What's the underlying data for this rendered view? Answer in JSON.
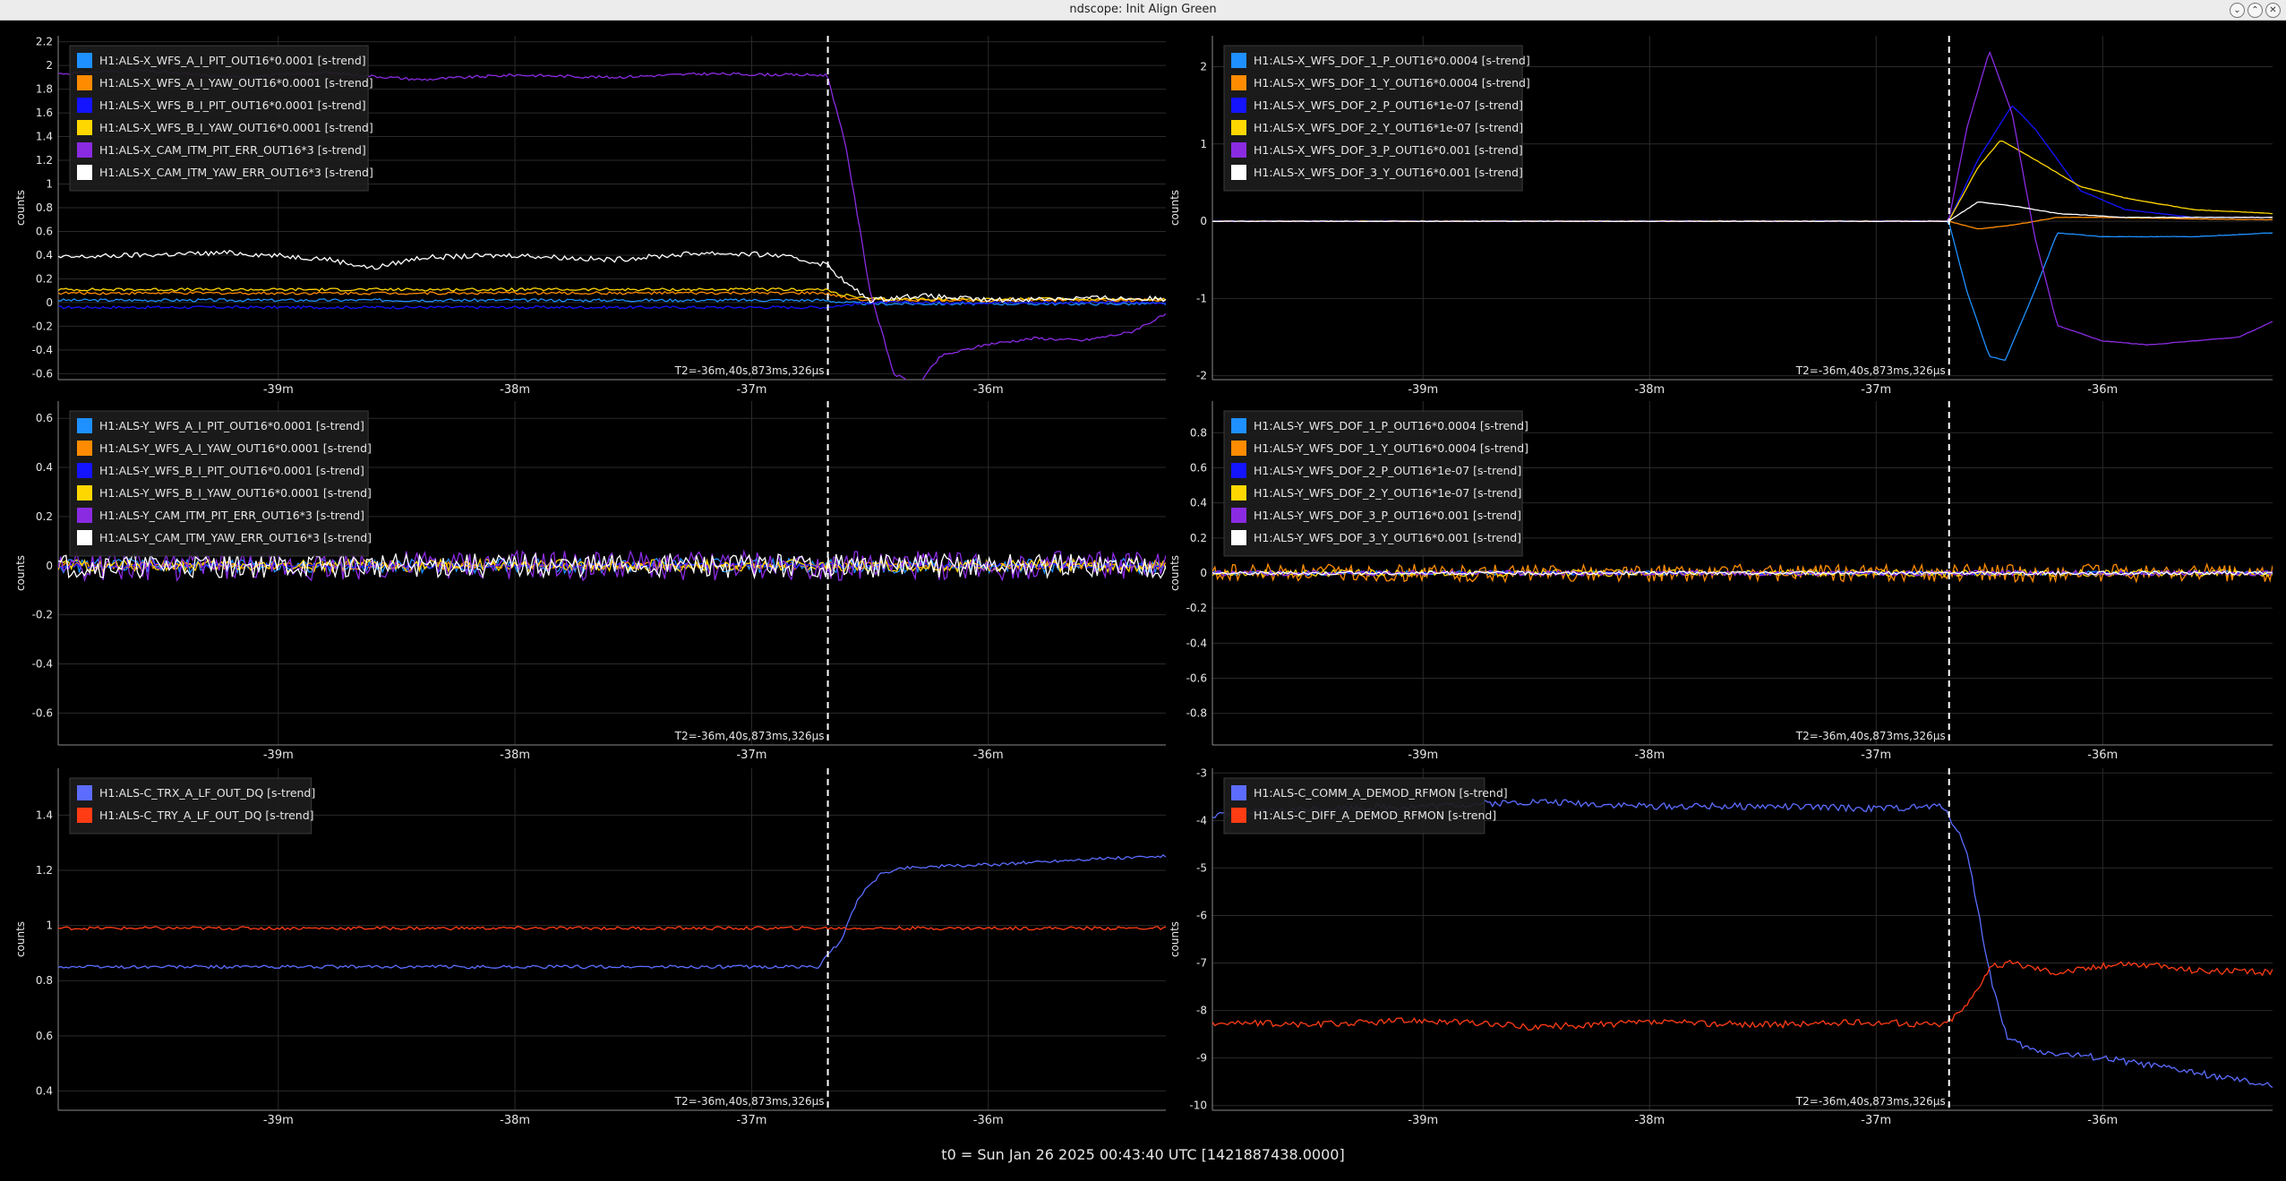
{
  "window": {
    "title": "ndscope: Init Align Green"
  },
  "footer": {
    "t0_text": "t0 = Sun Jan 26 2025 00:43:40 UTC [1421887438.0000]"
  },
  "colors": {
    "background": "#000000",
    "grid": "#2a2a2a",
    "axis": "#8a8a8a",
    "text": "#e6e6e6",
    "legend_bg": "#1c1c1c",
    "cursor": "#ffffff"
  },
  "chart_data": [
    {
      "id": "xarm-wfs",
      "type": "line",
      "ylabel": "counts",
      "ylim": [
        -0.65,
        2.25
      ],
      "yticks": [
        -0.6,
        -0.4,
        -0.2,
        0,
        0.2,
        0.4,
        0.6,
        0.8,
        1,
        1.2,
        1.4,
        1.6,
        1.8,
        2,
        2.2
      ],
      "xlim": [
        -39.93,
        -35.25
      ],
      "xticks": [
        -39,
        -38,
        -37,
        -36
      ],
      "xtick_labels": [
        "-39m",
        "-38m",
        "-37m",
        "-36m"
      ],
      "cursor_x": -36.678,
      "cursor_label": "T2=-36m,40s,873ms,326μs",
      "series": [
        {
          "name": "H1:ALS-X_WFS_A_I_PIT_OUT16*0.0001 [s-trend]",
          "color": "#1e90ff",
          "x": [
            -39.93,
            -36.7,
            -36.6,
            -36.5,
            -35.25
          ],
          "y": [
            0.02,
            0.02,
            0.0,
            -0.01,
            -0.01
          ]
        },
        {
          "name": "H1:ALS-X_WFS_A_I_YAW_OUT16*0.0001 [s-trend]",
          "color": "#ff8c00",
          "x": [
            -39.93,
            -36.7,
            -36.6,
            -36.5,
            -35.25
          ],
          "y": [
            0.08,
            0.08,
            0.04,
            0.02,
            0.02
          ]
        },
        {
          "name": "H1:ALS-X_WFS_B_I_PIT_OUT16*0.0001 [s-trend]",
          "color": "#1414ff",
          "x": [
            -39.93,
            -36.7,
            -36.6,
            -36.5,
            -35.25
          ],
          "y": [
            -0.04,
            -0.04,
            -0.02,
            0.0,
            0.0
          ]
        },
        {
          "name": "H1:ALS-X_WFS_B_I_YAW_OUT16*0.0001 [s-trend]",
          "color": "#ffd700",
          "x": [
            -39.93,
            -36.7,
            -36.6,
            -36.5,
            -35.25
          ],
          "y": [
            0.11,
            0.11,
            0.06,
            0.03,
            0.03
          ]
        },
        {
          "name": "H1:ALS-X_CAM_ITM_PIT_ERR_OUT16*3 [s-trend]",
          "color": "#8a2be2",
          "x": [
            -39.93,
            -39.6,
            -39.2,
            -38.8,
            -38.4,
            -38.0,
            -37.6,
            -37.2,
            -36.8,
            -36.68,
            -36.6,
            -36.5,
            -36.4,
            -36.3,
            -36.2,
            -36.0,
            -35.8,
            -35.6,
            -35.4,
            -35.25
          ],
          "y": [
            1.93,
            1.96,
            1.9,
            1.94,
            1.88,
            1.92,
            1.9,
            1.93,
            1.92,
            1.92,
            1.3,
            0.1,
            -0.6,
            -0.7,
            -0.45,
            -0.35,
            -0.3,
            -0.32,
            -0.25,
            -0.1
          ]
        },
        {
          "name": "H1:ALS-X_CAM_ITM_YAW_ERR_OUT16*3 [s-trend]",
          "color": "#ffffff",
          "x": [
            -39.93,
            -39.6,
            -39.2,
            -38.8,
            -38.6,
            -38.4,
            -38.0,
            -37.6,
            -37.2,
            -36.9,
            -36.68,
            -36.6,
            -36.5,
            -36.3,
            -36.0,
            -35.6,
            -35.25
          ],
          "y": [
            0.38,
            0.4,
            0.42,
            0.37,
            0.29,
            0.38,
            0.4,
            0.36,
            0.42,
            0.4,
            0.32,
            0.16,
            0.02,
            0.06,
            0.02,
            0.04,
            0.03
          ]
        }
      ]
    },
    {
      "id": "xarm-dof",
      "type": "line",
      "ylabel": "counts",
      "ylim": [
        -2.05,
        2.4
      ],
      "yticks": [
        -2,
        -1,
        0,
        1,
        2
      ],
      "xlim": [
        -39.93,
        -35.25
      ],
      "xticks": [
        -39,
        -38,
        -37,
        -36
      ],
      "xtick_labels": [
        "-39m",
        "-38m",
        "-37m",
        "-36m"
      ],
      "cursor_x": -36.678,
      "cursor_label": "T2=-36m,40s,873ms,326μs",
      "series": [
        {
          "name": "H1:ALS-X_WFS_DOF_1_P_OUT16*0.0004 [s-trend]",
          "color": "#1e90ff",
          "x": [
            -39.93,
            -36.68,
            -36.6,
            -36.5,
            -36.43,
            -36.3,
            -36.2,
            -36.0,
            -35.6,
            -35.25
          ],
          "y": [
            0,
            0,
            -0.9,
            -1.75,
            -1.8,
            -0.9,
            -0.15,
            -0.2,
            -0.2,
            -0.15
          ]
        },
        {
          "name": "H1:ALS-X_WFS_DOF_1_Y_OUT16*0.0004 [s-trend]",
          "color": "#ff8c00",
          "x": [
            -39.93,
            -36.68,
            -36.55,
            -36.4,
            -36.2,
            -36.0,
            -35.6,
            -35.25
          ],
          "y": [
            0,
            0,
            -0.1,
            -0.05,
            0.05,
            0.05,
            0.03,
            0.02
          ]
        },
        {
          "name": "H1:ALS-X_WFS_DOF_2_P_OUT16*1e-07 [s-trend]",
          "color": "#1414ff",
          "x": [
            -39.93,
            -36.68,
            -36.55,
            -36.4,
            -36.3,
            -36.1,
            -35.9,
            -35.6,
            -35.25
          ],
          "y": [
            0,
            0,
            0.8,
            1.5,
            1.2,
            0.4,
            0.15,
            0.05,
            0.05
          ]
        },
        {
          "name": "H1:ALS-X_WFS_DOF_2_Y_OUT16*1e-07 [s-trend]",
          "color": "#ffd700",
          "x": [
            -39.93,
            -36.68,
            -36.55,
            -36.45,
            -36.3,
            -36.1,
            -35.9,
            -35.6,
            -35.25
          ],
          "y": [
            0,
            0,
            0.7,
            1.05,
            0.8,
            0.45,
            0.3,
            0.15,
            0.1
          ]
        },
        {
          "name": "H1:ALS-X_WFS_DOF_3_P_OUT16*0.001 [s-trend]",
          "color": "#8a2be2",
          "x": [
            -39.93,
            -36.68,
            -36.6,
            -36.5,
            -36.4,
            -36.3,
            -36.2,
            -36.0,
            -35.8,
            -35.6,
            -35.4,
            -35.25
          ],
          "y": [
            0,
            0,
            1.2,
            2.2,
            1.4,
            -0.2,
            -1.35,
            -1.55,
            -1.6,
            -1.55,
            -1.5,
            -1.3
          ]
        },
        {
          "name": "H1:ALS-X_WFS_DOF_3_Y_OUT16*0.001 [s-trend]",
          "color": "#ffffff",
          "x": [
            -39.93,
            -36.68,
            -36.55,
            -36.4,
            -36.2,
            -35.9,
            -35.25
          ],
          "y": [
            0,
            0,
            0.25,
            0.2,
            0.1,
            0.05,
            0.05
          ]
        }
      ]
    },
    {
      "id": "yarm-wfs",
      "type": "line",
      "ylabel": "counts",
      "ylim": [
        -0.73,
        0.67
      ],
      "yticks": [
        -0.6,
        -0.4,
        -0.2,
        0,
        0.2,
        0.4,
        0.6
      ],
      "xlim": [
        -39.93,
        -35.25
      ],
      "xticks": [
        -39,
        -38,
        -37,
        -36
      ],
      "xtick_labels": [
        "-39m",
        "-38m",
        "-37m",
        "-36m"
      ],
      "cursor_x": -36.678,
      "cursor_label": "T2=-36m,40s,873ms,326μs",
      "series": [
        {
          "name": "H1:ALS-Y_WFS_A_I_PIT_OUT16*0.0001 [s-trend]",
          "color": "#1e90ff",
          "x": [
            -39.93,
            -35.25
          ],
          "y": [
            0,
            0
          ]
        },
        {
          "name": "H1:ALS-Y_WFS_A_I_YAW_OUT16*0.0001 [s-trend]",
          "color": "#ff8c00",
          "x": [
            -39.93,
            -35.25
          ],
          "y": [
            0,
            0
          ]
        },
        {
          "name": "H1:ALS-Y_WFS_B_I_PIT_OUT16*0.0001 [s-trend]",
          "color": "#1414ff",
          "x": [
            -39.93,
            -35.25
          ],
          "y": [
            0,
            0
          ]
        },
        {
          "name": "H1:ALS-Y_WFS_B_I_YAW_OUT16*0.0001 [s-trend]",
          "color": "#ffd700",
          "x": [
            -39.93,
            -35.25
          ],
          "y": [
            0,
            0
          ]
        },
        {
          "name": "H1:ALS-Y_CAM_ITM_PIT_ERR_OUT16*3 [s-trend]",
          "color": "#8a2be2",
          "x": [
            -39.93,
            -35.25
          ],
          "y": [
            0,
            0
          ]
        },
        {
          "name": "H1:ALS-Y_CAM_ITM_YAW_ERR_OUT16*3 [s-trend]",
          "color": "#ffffff",
          "x": [
            -39.93,
            -35.25
          ],
          "y": [
            0,
            0
          ]
        }
      ]
    },
    {
      "id": "yarm-dof",
      "type": "line",
      "ylabel": "counts",
      "ylim": [
        -0.98,
        0.98
      ],
      "yticks": [
        -0.8,
        -0.6,
        -0.4,
        -0.2,
        0,
        0.2,
        0.4,
        0.6,
        0.8
      ],
      "xlim": [
        -39.93,
        -35.25
      ],
      "xticks": [
        -39,
        -38,
        -37,
        -36
      ],
      "xtick_labels": [
        "-39m",
        "-38m",
        "-37m",
        "-36m"
      ],
      "cursor_x": -36.678,
      "cursor_label": "T2=-36m,40s,873ms,326μs",
      "series": [
        {
          "name": "H1:ALS-Y_WFS_DOF_1_P_OUT16*0.0004 [s-trend]",
          "color": "#1e90ff",
          "x": [
            -39.93,
            -35.25
          ],
          "y": [
            0,
            0
          ]
        },
        {
          "name": "H1:ALS-Y_WFS_DOF_1_Y_OUT16*0.0004 [s-trend]",
          "color": "#ff8c00",
          "x": [
            -39.93,
            -35.25
          ],
          "y": [
            0,
            0
          ]
        },
        {
          "name": "H1:ALS-Y_WFS_DOF_2_P_OUT16*1e-07 [s-trend]",
          "color": "#1414ff",
          "x": [
            -39.93,
            -35.25
          ],
          "y": [
            0,
            0
          ]
        },
        {
          "name": "H1:ALS-Y_WFS_DOF_2_Y_OUT16*1e-07 [s-trend]",
          "color": "#ffd700",
          "x": [
            -39.93,
            -35.25
          ],
          "y": [
            0,
            0
          ]
        },
        {
          "name": "H1:ALS-Y_WFS_DOF_3_P_OUT16*0.001 [s-trend]",
          "color": "#8a2be2",
          "x": [
            -39.93,
            -35.25
          ],
          "y": [
            0,
            0
          ]
        },
        {
          "name": "H1:ALS-Y_WFS_DOF_3_Y_OUT16*0.001 [s-trend]",
          "color": "#ffffff",
          "x": [
            -39.93,
            -35.25
          ],
          "y": [
            0,
            0
          ]
        }
      ]
    },
    {
      "id": "trans",
      "type": "line",
      "ylabel": "counts",
      "ylim": [
        0.33,
        1.57
      ],
      "yticks": [
        0.4,
        0.6,
        0.8,
        1,
        1.2,
        1.4
      ],
      "xlim": [
        -39.93,
        -35.25
      ],
      "xticks": [
        -39,
        -38,
        -37,
        -36
      ],
      "xtick_labels": [
        "-39m",
        "-38m",
        "-37m",
        "-36m"
      ],
      "cursor_x": -36.678,
      "cursor_label": "T2=-36m,40s,873ms,326μs",
      "series": [
        {
          "name": "H1:ALS-C_TRX_A_LF_OUT_DQ [s-trend]",
          "color": "#5b6cff",
          "x": [
            -39.93,
            -36.72,
            -36.62,
            -36.55,
            -36.45,
            -36.35,
            -36.0,
            -35.6,
            -35.25
          ],
          "y": [
            0.85,
            0.85,
            0.95,
            1.1,
            1.19,
            1.21,
            1.22,
            1.24,
            1.25
          ]
        },
        {
          "name": "H1:ALS-C_TRY_A_LF_OUT_DQ [s-trend]",
          "color": "#ff3c14",
          "x": [
            -39.93,
            -35.25
          ],
          "y": [
            0.99,
            0.99
          ]
        }
      ]
    },
    {
      "id": "demod",
      "type": "line",
      "ylabel": "counts",
      "ylim": [
        -10.1,
        -2.9
      ],
      "yticks": [
        -10,
        -9,
        -8,
        -7,
        -6,
        -5,
        -4,
        -3
      ],
      "xlim": [
        -39.93,
        -35.25
      ],
      "xticks": [
        -39,
        -38,
        -37,
        -36
      ],
      "xtick_labels": [
        "-39m",
        "-38m",
        "-37m",
        "-36m"
      ],
      "cursor_x": -36.678,
      "cursor_label": "T2=-36m,40s,873ms,326μs",
      "series": [
        {
          "name": "H1:ALS-C_COMM_A_DEMOD_RFMON [s-trend]",
          "color": "#5b6cff",
          "x": [
            -39.93,
            -39.5,
            -39.0,
            -38.5,
            -38.0,
            -37.5,
            -37.0,
            -36.7,
            -36.6,
            -36.5,
            -36.42,
            -36.3,
            -36.0,
            -35.6,
            -35.25
          ],
          "y": [
            -3.9,
            -3.75,
            -3.7,
            -3.6,
            -3.7,
            -3.7,
            -3.75,
            -3.7,
            -4.6,
            -7.2,
            -8.6,
            -8.85,
            -9.0,
            -9.3,
            -9.6
          ]
        },
        {
          "name": "H1:ALS-C_DIFF_A_DEMOD_RFMON [s-trend]",
          "color": "#ff3c14",
          "x": [
            -39.93,
            -39.5,
            -39.0,
            -38.5,
            -38.0,
            -37.5,
            -37.0,
            -36.7,
            -36.6,
            -36.5,
            -36.4,
            -36.2,
            -35.9,
            -35.6,
            -35.25
          ],
          "y": [
            -8.25,
            -8.3,
            -8.2,
            -8.35,
            -8.25,
            -8.3,
            -8.25,
            -8.3,
            -7.9,
            -7.1,
            -7.0,
            -7.2,
            -7.0,
            -7.15,
            -7.2
          ]
        }
      ]
    }
  ]
}
